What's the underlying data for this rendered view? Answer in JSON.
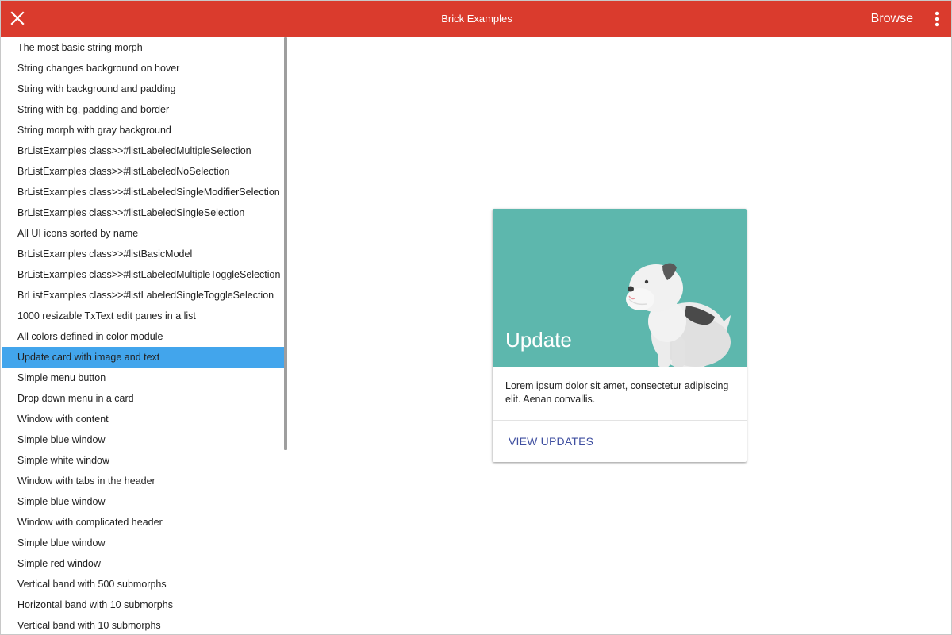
{
  "window": {
    "title": "Brick Examples",
    "browse_label": "Browse",
    "accent_color": "#da3b2d",
    "selection_color": "#42a5ec"
  },
  "icons": {
    "close": "close-icon",
    "more": "more-vertical-icon",
    "dog": "bulldog-illustration"
  },
  "sidebar": {
    "items": [
      {
        "label": "The most basic string morph"
      },
      {
        "label": "String changes background on hover"
      },
      {
        "label": "String with background and padding"
      },
      {
        "label": "String with bg, padding and border"
      },
      {
        "label": "String morph with gray background"
      },
      {
        "label": "BrListExamples class>>#listLabeledMultipleSelection"
      },
      {
        "label": "BrListExamples class>>#listLabeledNoSelection"
      },
      {
        "label": "BrListExamples class>>#listLabeledSingleModifierSelection"
      },
      {
        "label": "BrListExamples class>>#listLabeledSingleSelection"
      },
      {
        "label": "All UI icons sorted by name"
      },
      {
        "label": "BrListExamples class>>#listBasicModel"
      },
      {
        "label": "BrListExamples class>>#listLabeledMultipleToggleSelection"
      },
      {
        "label": "BrListExamples class>>#listLabeledSingleToggleSelection"
      },
      {
        "label": "1000 resizable TxText edit panes in a list"
      },
      {
        "label": "All colors defined in color module"
      },
      {
        "label": "Update card with image and text",
        "selected": true
      },
      {
        "label": "Simple menu button"
      },
      {
        "label": "Drop down menu in a card"
      },
      {
        "label": "Window with content"
      },
      {
        "label": "Simple blue window"
      },
      {
        "label": "Simple white window"
      },
      {
        "label": "Window with tabs in the header"
      },
      {
        "label": "Simple blue window"
      },
      {
        "label": "Window with complicated header"
      },
      {
        "label": "Simple blue window"
      },
      {
        "label": "Simple red window"
      },
      {
        "label": "Vertical band with 500 submorphs"
      },
      {
        "label": "Horizontal band with 10 submorphs"
      },
      {
        "label": "Vertical band with 10 submorphs"
      }
    ]
  },
  "card": {
    "title": "Update",
    "text": "Lorem ipsum dolor sit amet, consectetur adipiscing elit. Aenan convallis.",
    "action_label": "VIEW UPDATES",
    "media_color": "#5db7ad",
    "action_color": "#3f4fa0"
  }
}
